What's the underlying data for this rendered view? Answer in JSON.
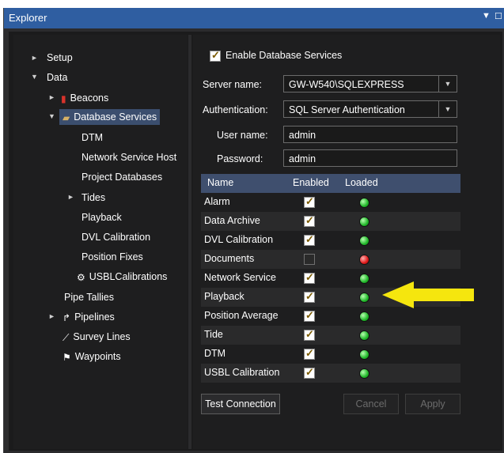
{
  "window": {
    "title": "Explorer"
  },
  "tree": {
    "setup": "Setup",
    "data": "Data",
    "beacons": "Beacons",
    "database_services": "Database Services",
    "dtm": "DTM",
    "network_service_host": "Network Service Host",
    "project_databases": "Project Databases",
    "tides": "Tides",
    "playback": "Playback",
    "dvl_calibration": "DVL Calibration",
    "position_fixes": "Position Fixes",
    "usbl_calibrations": "USBLCalibrations",
    "pipe_tallies": "Pipe Tallies",
    "pipelines": "Pipelines",
    "survey_lines": "Survey Lines",
    "waypoints": "Waypoints"
  },
  "settings": {
    "enable_label": "Enable Database Services",
    "enable_checked": true,
    "server_label": "Server name:",
    "server_value": "GW-W540\\SQLEXPRESS",
    "auth_label": "Authentication:",
    "auth_value": "SQL Server Authentication",
    "user_label": "User name:",
    "user_value": "admin",
    "password_label": "Password:",
    "password_value": "admin"
  },
  "grid": {
    "headers": {
      "name": "Name",
      "enabled": "Enabled",
      "loaded": "Loaded"
    },
    "rows": [
      {
        "name": "Alarm",
        "enabled": true,
        "loaded": "green"
      },
      {
        "name": "Data Archive",
        "enabled": true,
        "loaded": "green"
      },
      {
        "name": "DVL Calibration",
        "enabled": true,
        "loaded": "green"
      },
      {
        "name": "Documents",
        "enabled": false,
        "loaded": "red"
      },
      {
        "name": "Network Service",
        "enabled": true,
        "loaded": "green"
      },
      {
        "name": "Playback",
        "enabled": true,
        "loaded": "green"
      },
      {
        "name": "Position Average",
        "enabled": true,
        "loaded": "green"
      },
      {
        "name": "Tide",
        "enabled": true,
        "loaded": "green"
      },
      {
        "name": "DTM",
        "enabled": true,
        "loaded": "green"
      },
      {
        "name": "USBL Calibration",
        "enabled": true,
        "loaded": "green"
      }
    ]
  },
  "buttons": {
    "test": "Test Connection",
    "cancel": "Cancel",
    "apply": "Apply"
  },
  "colors": {
    "titlebar": "#2f5ea1",
    "grid_header": "#3f4f6e",
    "arrow": "#f5e60e"
  }
}
